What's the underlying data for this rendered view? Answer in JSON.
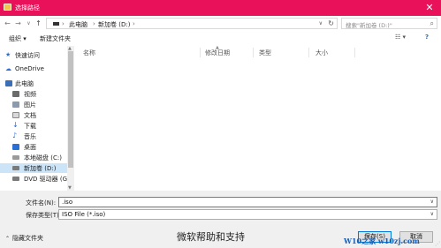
{
  "window": {
    "title": "选择路径"
  },
  "address": {
    "crumbs": [
      "此电脑",
      "新加卷 (D:)"
    ]
  },
  "search": {
    "placeholder": "搜索\"新加卷 (D:)\""
  },
  "toolbar": {
    "organize": "组织 ▾",
    "new_folder": "新建文件夹"
  },
  "sidebar": {
    "items": [
      {
        "label": "快速访问",
        "icon": "star-icon",
        "color": "#2b6fd6"
      },
      {
        "label": "OneDrive",
        "icon": "cloud-icon",
        "color": "#2b6fd6"
      },
      {
        "label": "此电脑",
        "icon": "computer-icon",
        "color": "#3a6fb8"
      },
      {
        "label": "视频",
        "icon": "video-icon",
        "color": "#6b6b6b"
      },
      {
        "label": "图片",
        "icon": "picture-icon",
        "color": "#6b6b6b"
      },
      {
        "label": "文档",
        "icon": "document-icon",
        "color": "#6b6b6b"
      },
      {
        "label": "下载",
        "icon": "download-icon",
        "color": "#2b6fd6"
      },
      {
        "label": "音乐",
        "icon": "music-icon",
        "color": "#2b6fd6"
      },
      {
        "label": "桌面",
        "icon": "desktop-icon",
        "color": "#2b6fd6"
      },
      {
        "label": "本地磁盘 (C:)",
        "icon": "drive-icon",
        "color": "#7a7a7a"
      },
      {
        "label": "新加卷 (D:)",
        "icon": "drive-icon",
        "color": "#7a7a7a"
      },
      {
        "label": "DVD 驱动器 (G:",
        "icon": "dvd-icon",
        "color": "#7a7a7a"
      }
    ]
  },
  "columns": [
    "名称",
    "修改日期",
    "类型",
    "大小"
  ],
  "form": {
    "filename_label": "文件名(N):",
    "filename_value": ".iso",
    "filetype_label": "保存类型(T):",
    "filetype_value": "ISO File (*.iso)"
  },
  "footer": {
    "hide_folders": "隐藏文件夹",
    "save": "保存(S)",
    "cancel": "取消",
    "watermark": "微软帮助和支持",
    "logo": "W10之家 w10zj.com"
  },
  "colors": {
    "titlebar": "#e8115a",
    "selection": "#cce4f7",
    "primary_border": "#0078d7"
  }
}
